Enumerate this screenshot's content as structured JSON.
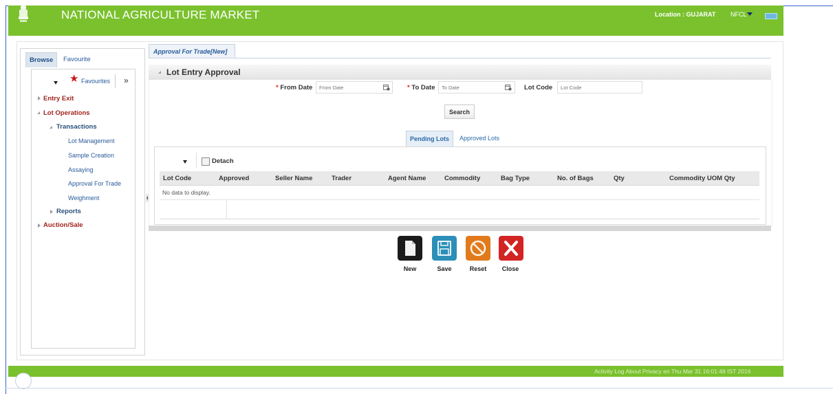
{
  "header": {
    "title": "NATIONAL AGRICULTURE MARKET",
    "location": "Location : GUJARAT",
    "user": "NFCL",
    "brand_color": "#7ac12d"
  },
  "nav": {
    "tabs": [
      "Browse",
      "Favourite"
    ],
    "favourites_label": "Favourites",
    "expand_label": "»",
    "tree": {
      "entry_exit": "Entry Exit",
      "lot_operations": "Lot Operations",
      "transactions": "Transactions",
      "leaves": [
        "Lot Management",
        "Sample Creation",
        "Assaying",
        "Approval For Trade",
        "Weighment"
      ],
      "reports": "Reports",
      "auction_sale": "Auction/Sale"
    }
  },
  "document_tab": "Approval For Trade[New]",
  "section": {
    "title": "Lot Entry Approval"
  },
  "form": {
    "from_date_label": "From Date",
    "from_date_placeholder": "From Date",
    "to_date_label": "To Date",
    "to_date_placeholder": "To Date",
    "lot_code_label": "Lot Code",
    "lot_code_placeholder": "Lot Code",
    "required_mark": "*",
    "search_label": "Search"
  },
  "lot_tabs": [
    "Pending Lots",
    "Approved Lots"
  ],
  "table": {
    "detach_label": "Detach",
    "columns": [
      "Lot Code",
      "Approved",
      "Seller Name",
      "Trader",
      "Agent Name",
      "Commodity",
      "Bag Type",
      "No. of Bags",
      "Qty",
      "Commodity UOM Qty"
    ],
    "empty_message": "No data to display."
  },
  "actions": {
    "new": "New",
    "save": "Save",
    "reset": "Reset",
    "close": "Close"
  },
  "footer": {
    "text": "Activity Log   About   Privacy   en   Thu Mar 31 16:01:48 IST 2016"
  },
  "icons": [
    "emblem-icon",
    "caret-down-icon",
    "keyboard-icon",
    "star-icon",
    "calendar-icon",
    "detach-icon",
    "new-document-icon",
    "save-disk-icon",
    "reset-circle-icon",
    "close-x-icon"
  ]
}
